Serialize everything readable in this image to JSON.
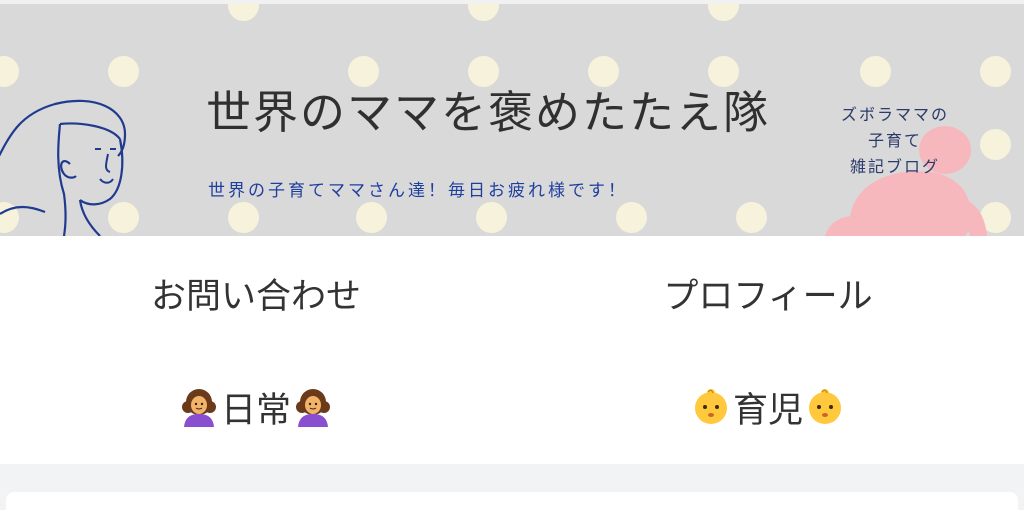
{
  "header": {
    "title": "世界のママを褒めたたえ隊",
    "tagline": "世界の子育てママさん達！毎日お疲れ様です！",
    "blog_tag_lines": [
      "ズボラママの",
      "子育て",
      "雑記ブログ"
    ]
  },
  "nav": {
    "items": [
      {
        "label": "お問い合わせ"
      },
      {
        "label": "プロフィール"
      },
      {
        "label": "日常",
        "icon": "woman-curly-hair-icon"
      },
      {
        "label": "育児",
        "icon": "baby-icon"
      }
    ]
  },
  "colors": {
    "header_bg": "#d9d9d9",
    "dot": "#f7f2dc",
    "tagline": "#1f3f9f",
    "baby_silhouette": "#f6b8bd",
    "line_art": "#1f3a8f"
  }
}
